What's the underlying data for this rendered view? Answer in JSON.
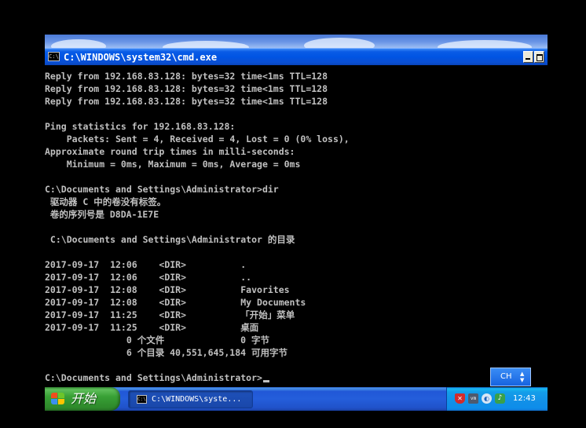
{
  "window": {
    "title": "C:\\WINDOWS\\system32\\cmd.exe",
    "icon_label": "C:\\"
  },
  "console_lines": [
    "Reply from 192.168.83.128: bytes=32 time<1ms TTL=128",
    "Reply from 192.168.83.128: bytes=32 time<1ms TTL=128",
    "Reply from 192.168.83.128: bytes=32 time<1ms TTL=128",
    "",
    "Ping statistics for 192.168.83.128:",
    "    Packets: Sent = 4, Received = 4, Lost = 0 (0% loss),",
    "Approximate round trip times in milli-seconds:",
    "    Minimum = 0ms, Maximum = 0ms, Average = 0ms",
    "",
    "C:\\Documents and Settings\\Administrator>dir",
    " 驱动器 C 中的卷没有标签。",
    " 卷的序列号是 D8DA-1E7E",
    "",
    " C:\\Documents and Settings\\Administrator 的目录",
    "",
    "2017-09-17  12:06    <DIR>          .",
    "2017-09-17  12:06    <DIR>          ..",
    "2017-09-17  12:08    <DIR>          Favorites",
    "2017-09-17  12:08    <DIR>          My Documents",
    "2017-09-17  11:25    <DIR>          「开始」菜单",
    "2017-09-17  11:25    <DIR>          桌面",
    "               0 个文件              0 字节",
    "               6 个目录 40,551,645,184 可用字节",
    "",
    "C:\\Documents and Settings\\Administrator>"
  ],
  "ime": {
    "label": "CH",
    "arrows": "▲▼"
  },
  "taskbar": {
    "start_label": "开始",
    "task_item_label": "C:\\WINDOWS\\syste...",
    "task_icon_label": "C:\\",
    "clock": "12:43"
  },
  "tray_icons": [
    "shield-icon",
    "vm-icon",
    "network-icon",
    "sound-icon"
  ],
  "colors": {
    "console_text": "#c0c0c0",
    "console_bg": "#000000",
    "titlebar": "#0054e3",
    "start_button": "#38a035",
    "tray": "#1290e8"
  }
}
